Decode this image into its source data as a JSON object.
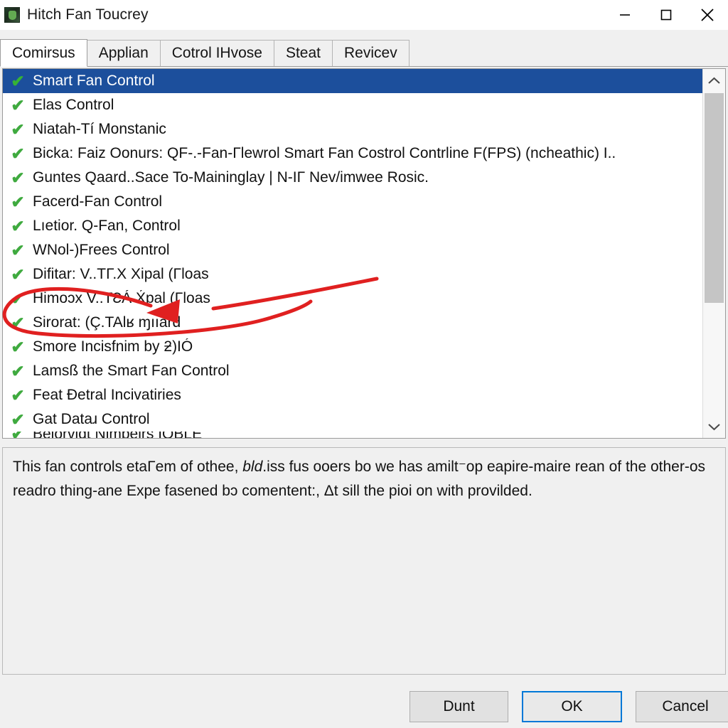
{
  "window": {
    "title": "Hitch Fan Toucrey",
    "icon": "app-icon",
    "minimize_label": "–",
    "maximize_label": "□",
    "close_label": "✕"
  },
  "tabs": [
    {
      "label": "Comirsus",
      "active": true
    },
    {
      "label": "Applian",
      "active": false
    },
    {
      "label": "Cotrol IHvose",
      "active": false
    },
    {
      "label": "Steat",
      "active": false
    },
    {
      "label": "Revicev",
      "active": false
    }
  ],
  "list": {
    "check_glyph": "✔",
    "items": [
      {
        "label": "Smart Fan Control",
        "checked": true,
        "selected": true
      },
      {
        "label": "Elas Control",
        "checked": true,
        "selected": false
      },
      {
        "label": "Niatah-Tí Monstanic",
        "checked": true,
        "selected": false
      },
      {
        "label": "Bicka: Faiz Oonurs: QF-.-Fan-Γlewrol Smart Fan Costrol Contrline F(FPS) (ncheathic) I..",
        "checked": true,
        "selected": false
      },
      {
        "label": "Guntes Qaard..Sace To-Maininglay | N-IΓ Nev/imwee Rosic.",
        "checked": true,
        "selected": false
      },
      {
        "label": "Facerd-Fan Control",
        "checked": true,
        "selected": false
      },
      {
        "label": "Lıetior. Q-Fan, Control",
        "checked": true,
        "selected": false
      },
      {
        "label": "WNol-)Frees Control",
        "checked": true,
        "selected": false
      },
      {
        "label": "Difitar: V..TΓ.X Xipal (Γloas",
        "checked": true,
        "selected": false
      },
      {
        "label": "Himoɔx V..TƐÁ X́pal (Γloas",
        "checked": true,
        "selected": false
      },
      {
        "label": "Sirorat: (Ç.TAlʁ ɱııard",
        "checked": true,
        "selected": false
      },
      {
        "label": "Smore Incisfnim by ƻ)IÓ",
        "checked": true,
        "selected": false
      },
      {
        "label": "Lamsß the Smart Fan Control",
        "checked": true,
        "selected": false
      },
      {
        "label": "Feat Ɖetral Incivatiries",
        "checked": true,
        "selected": false
      },
      {
        "label": "Gat Dataɹ Control",
        "checked": true,
        "selected": false
      },
      {
        "label": "Belorvidt Nimbeirs IOBLE",
        "checked": true,
        "selected": false
      }
    ],
    "scrollbar": {
      "up_arrow": "▲",
      "down_arrow": "▼"
    }
  },
  "description": {
    "line1_a": "This fan controls etaΓem of othee, ",
    "line1_em": "bld",
    "line1_b": ".iss fus ooers bo we has amilt⁻op eapire-maire rean",
    "line2": "of the other-os readro thing-ane Expe fasened bɔ comentent:, Δt sill the pioi on with",
    "line3": "provilded."
  },
  "buttons": {
    "apply": "Dunt",
    "ok": "OK",
    "cancel": "Cancel"
  },
  "annotation": {
    "type": "red-arrow-ellipse",
    "color": "#e02020",
    "target_item_index": 10
  },
  "colors": {
    "selection_blue": "#1c4f9c",
    "check_green": "#3faa3f",
    "focus_blue": "#0078d7",
    "annotation_red": "#e02020"
  }
}
